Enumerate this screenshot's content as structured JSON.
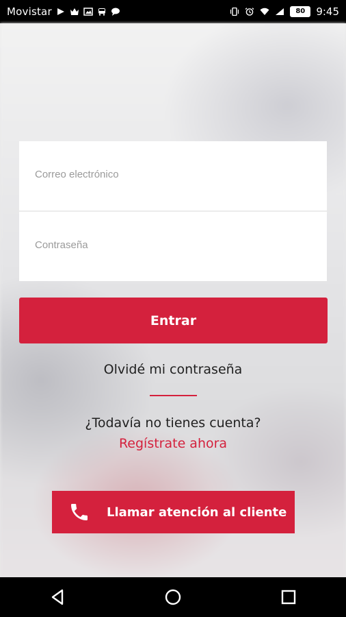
{
  "status_bar": {
    "carrier": "Movistar",
    "battery": "80",
    "time": "9:45",
    "icons": [
      "play-icon",
      "crown-icon",
      "image-icon",
      "bus-icon",
      "chat-icon",
      "vibrate-icon",
      "alarm-icon",
      "wifi-icon",
      "signal-icon",
      "battery-icon"
    ]
  },
  "login": {
    "email_placeholder": "Correo electrónico",
    "password_placeholder": "Contraseña",
    "submit_label": "Entrar",
    "forgot_label": "Olvidé mi contraseña",
    "no_account_text": "¿Todavía no tienes cuenta?",
    "register_label": "Regístrate ahora"
  },
  "call": {
    "icon": "phone-icon",
    "label": "Llamar atención al cliente"
  },
  "nav_bar": {
    "icons": [
      "back-icon",
      "home-icon",
      "recents-icon"
    ]
  },
  "colors": {
    "accent": "#d4213d",
    "status_bar": "#000000",
    "card": "#ffffff"
  }
}
